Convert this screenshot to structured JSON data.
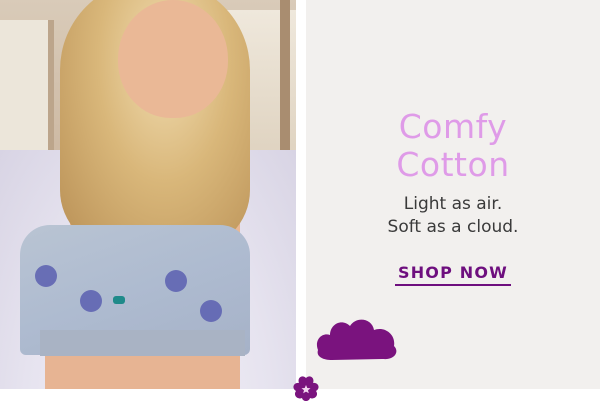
{
  "banner": {
    "headline_line1": "Comfy",
    "headline_line2": "Cotton",
    "subline_line1": "Light as air.",
    "subline_line2": "Soft as a cloud.",
    "cta_label": "SHOP NOW"
  },
  "colors": {
    "headline": "#df9be8",
    "body_text": "#3a3a3a",
    "cta": "#6e0f7e",
    "accent_shape": "#7a137e",
    "panel_bg": "#f2f0ee"
  },
  "icons": {
    "cloud_shape": "purple-cloud-shape",
    "logo": "flower-logo-icon"
  }
}
